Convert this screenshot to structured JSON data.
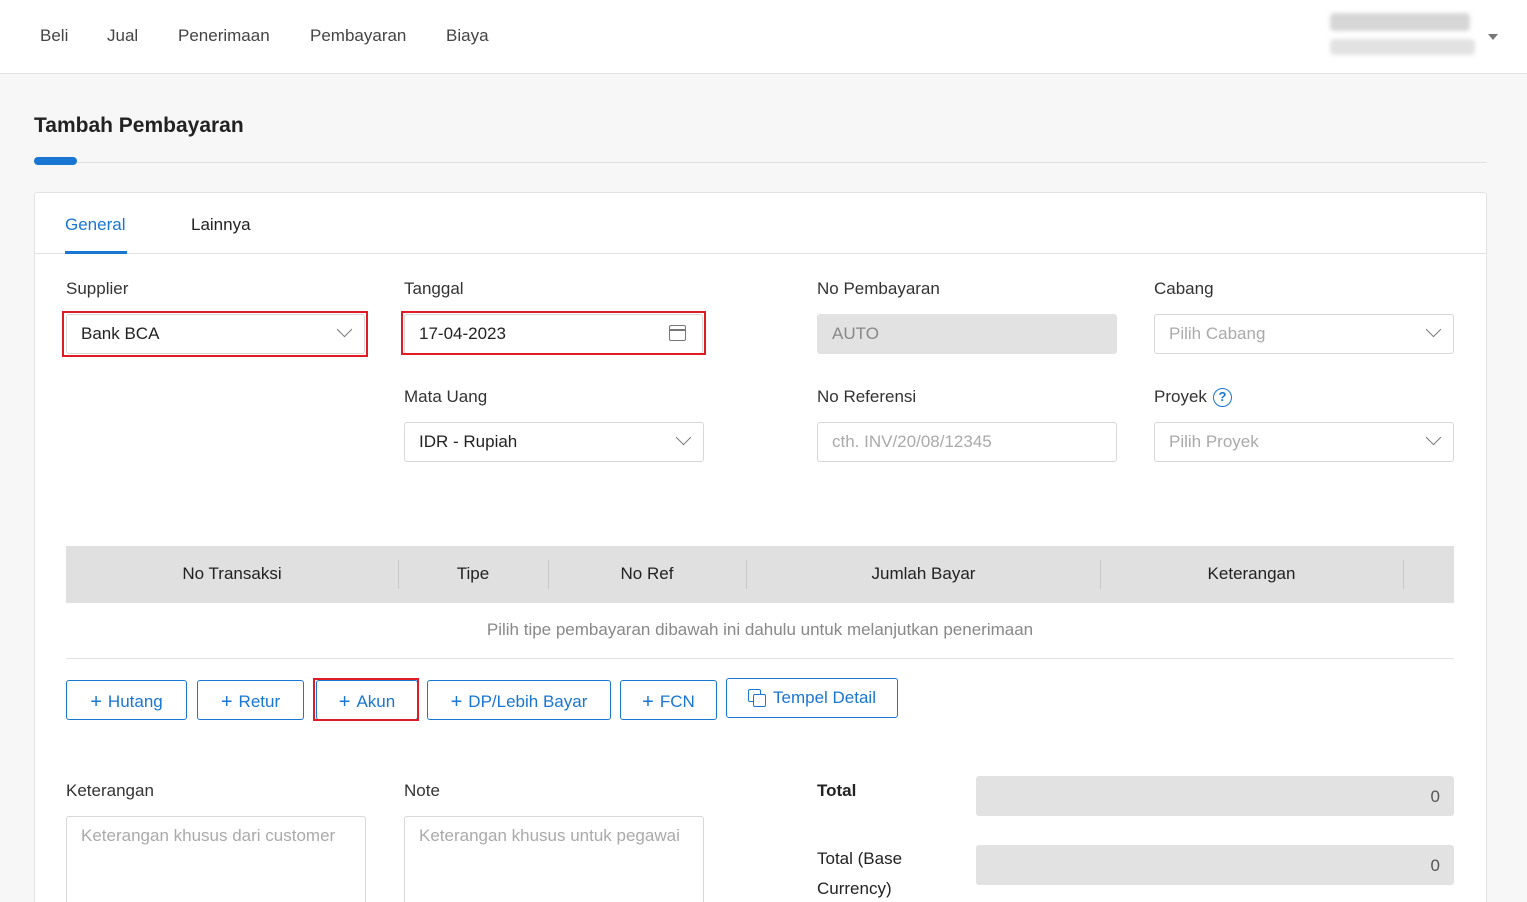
{
  "nav": {
    "items": [
      "Beli",
      "Jual",
      "Penerimaan",
      "Pembayaran",
      "Biaya"
    ]
  },
  "page": {
    "title": "Tambah Pembayaran"
  },
  "tabs": {
    "general": "General",
    "lainnya": "Lainnya"
  },
  "form": {
    "supplier": {
      "label": "Supplier",
      "value": "Bank BCA"
    },
    "tanggal": {
      "label": "Tanggal",
      "value": "17-04-2023"
    },
    "no_pembayaran": {
      "label": "No Pembayaran",
      "value": "AUTO"
    },
    "cabang": {
      "label": "Cabang",
      "placeholder": "Pilih Cabang"
    },
    "mata_uang": {
      "label": "Mata Uang",
      "value": "IDR - Rupiah"
    },
    "no_referensi": {
      "label": "No Referensi",
      "placeholder": "cth. INV/20/08/12345"
    },
    "proyek": {
      "label": "Proyek",
      "placeholder": "Pilih Proyek",
      "help_symbol": "?"
    }
  },
  "table": {
    "headers": [
      "No Transaksi",
      "Tipe",
      "No Ref",
      "Jumlah Bayar",
      "Keterangan"
    ],
    "empty_message": "Pilih tipe pembayaran dibawah ini dahulu untuk melanjutkan penerimaan"
  },
  "buttons": {
    "plus": "+",
    "hutang": "Hutang",
    "retur": "Retur",
    "akun": "Akun",
    "dp": "DP/Lebih Bayar",
    "fcn": "FCN",
    "tempel": "Tempel Detail"
  },
  "footer": {
    "keterangan": {
      "label": "Keterangan",
      "placeholder": "Keterangan khusus dari customer"
    },
    "note": {
      "label": "Note",
      "placeholder": "Keterangan khusus untuk pegawai"
    },
    "total": {
      "label": "Total",
      "value": "0"
    },
    "total_base": {
      "label_line1": "Total (Base",
      "label_line2": "Currency)",
      "value": "0"
    }
  },
  "colors": {
    "accent": "#1976d2",
    "highlight": "#e01b24"
  }
}
